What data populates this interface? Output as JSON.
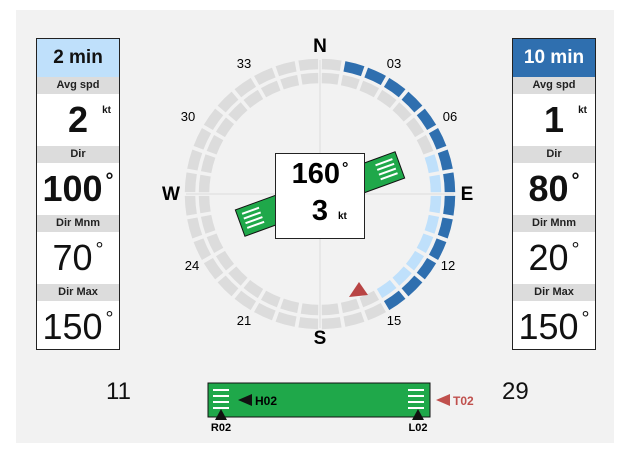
{
  "left_panel": {
    "header": "2 min",
    "avg_spd_label": "Avg spd",
    "avg_spd_value": "2",
    "avg_spd_unit": "kt",
    "dir_label": "Dir",
    "dir_value": "100",
    "dir_mnm_label": "Dir Mnm",
    "dir_mnm_value": "70",
    "dir_max_label": "Dir Max",
    "dir_max_value": "150",
    "header_color": "#bfe0fb"
  },
  "right_panel": {
    "header": "10 min",
    "avg_spd_label": "Avg spd",
    "avg_spd_value": "1",
    "avg_spd_unit": "kt",
    "dir_label": "Dir",
    "dir_value": "80",
    "dir_mnm_label": "Dir Mnm",
    "dir_mnm_value": "20",
    "dir_max_label": "Dir Max",
    "dir_max_value": "150",
    "header_color": "#2f6faf"
  },
  "compass": {
    "cardinals": {
      "north": "N",
      "east": "E",
      "south": "S",
      "west": "W"
    },
    "ticks": [
      "03",
      "06",
      "12",
      "15",
      "21",
      "24",
      "30",
      "33"
    ],
    "dark_range_color": "#2f6faf",
    "light_range_color": "#bfe0fb",
    "pointer_color": "#b84444"
  },
  "center": {
    "direction": "160",
    "degree_symbol": "°",
    "speed": "3",
    "speed_unit": "kt"
  },
  "runway": {
    "left_end": "11",
    "right_end": "29",
    "h_label": "H02",
    "t_label": "T02",
    "r_label": "R02",
    "l_label": "L02",
    "runway_color": "#1fa84a",
    "t_color": "#c0504d"
  }
}
